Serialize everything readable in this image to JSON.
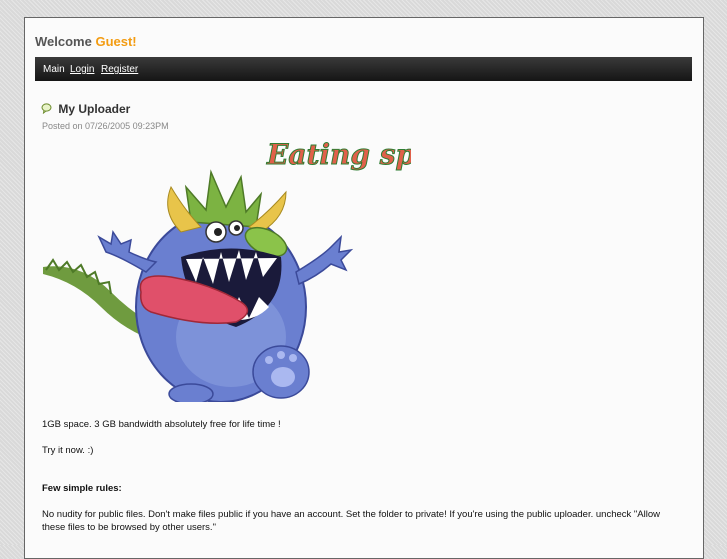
{
  "header": {
    "welcome_prefix": "Welcome",
    "welcome_name": "Guest!"
  },
  "nav": {
    "items": [
      "Main",
      "Login",
      "Register"
    ]
  },
  "post": {
    "title": "My Uploader",
    "posted_on": "Posted on 07/26/2005 09:23PM",
    "banner_text": "Eating space!",
    "line1": "1GB space. 3 GB bandwidth absolutely free for life time !",
    "line2": "Try it now. :)",
    "rules_heading": "Few simple rules:",
    "rules_text": "No nudity for public files. Don't make files public if you have an account. Set the folder to private! If you're using the public uploader. uncheck \"Allow these files to be browsed by other users.\""
  },
  "colors": {
    "accent": "#f39c12",
    "navbar": "#222222"
  }
}
